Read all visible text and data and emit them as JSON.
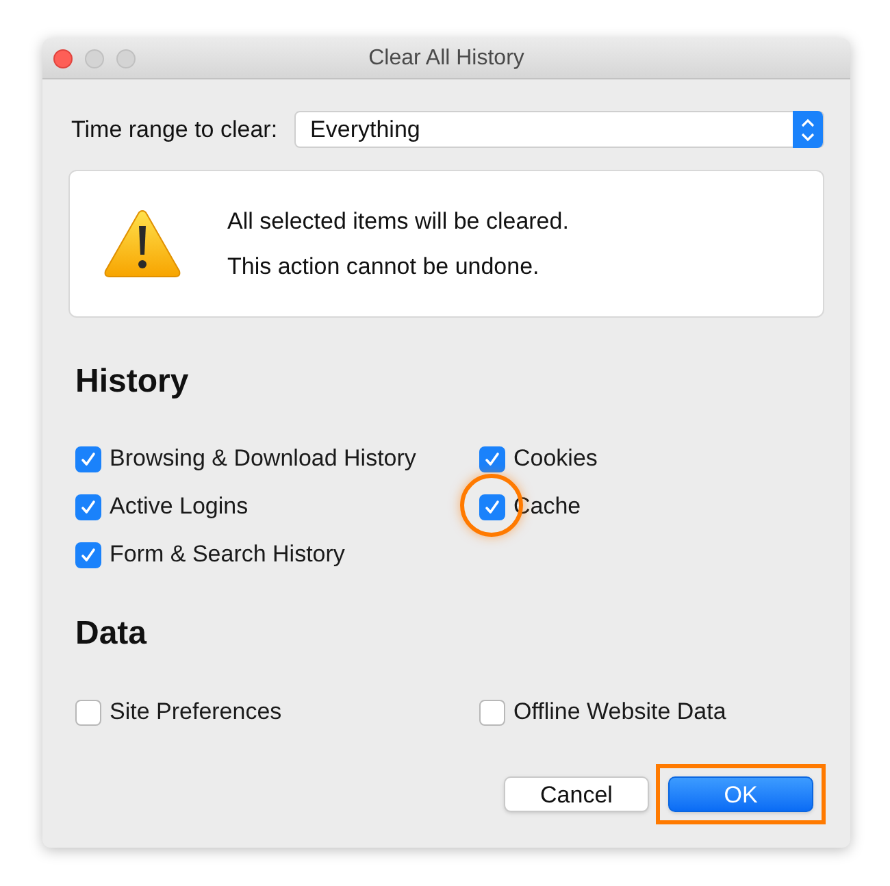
{
  "window": {
    "title": "Clear All History"
  },
  "time_range": {
    "label": "Time range to clear:",
    "value": "Everything"
  },
  "warning": {
    "lines": [
      "All selected items will be cleared.",
      "This action cannot be undone."
    ]
  },
  "sections": [
    {
      "title": "History",
      "items": [
        {
          "label": "Browsing & Download History",
          "checked": true,
          "highlighted": false
        },
        {
          "label": "Cookies",
          "checked": true,
          "highlighted": false
        },
        {
          "label": "Active Logins",
          "checked": true,
          "highlighted": false
        },
        {
          "label": "Cache",
          "checked": true,
          "highlighted": true
        },
        {
          "label": "Form & Search History",
          "checked": true,
          "highlighted": false
        }
      ]
    },
    {
      "title": "Data",
      "items": [
        {
          "label": "Site Preferences",
          "checked": false,
          "highlighted": false
        },
        {
          "label": "Offline Website Data",
          "checked": false,
          "highlighted": false
        }
      ]
    }
  ],
  "buttons": [
    {
      "label": "Cancel",
      "kind": "secondary",
      "highlighted": false
    },
    {
      "label": "OK",
      "kind": "primary",
      "highlighted": true
    }
  ]
}
